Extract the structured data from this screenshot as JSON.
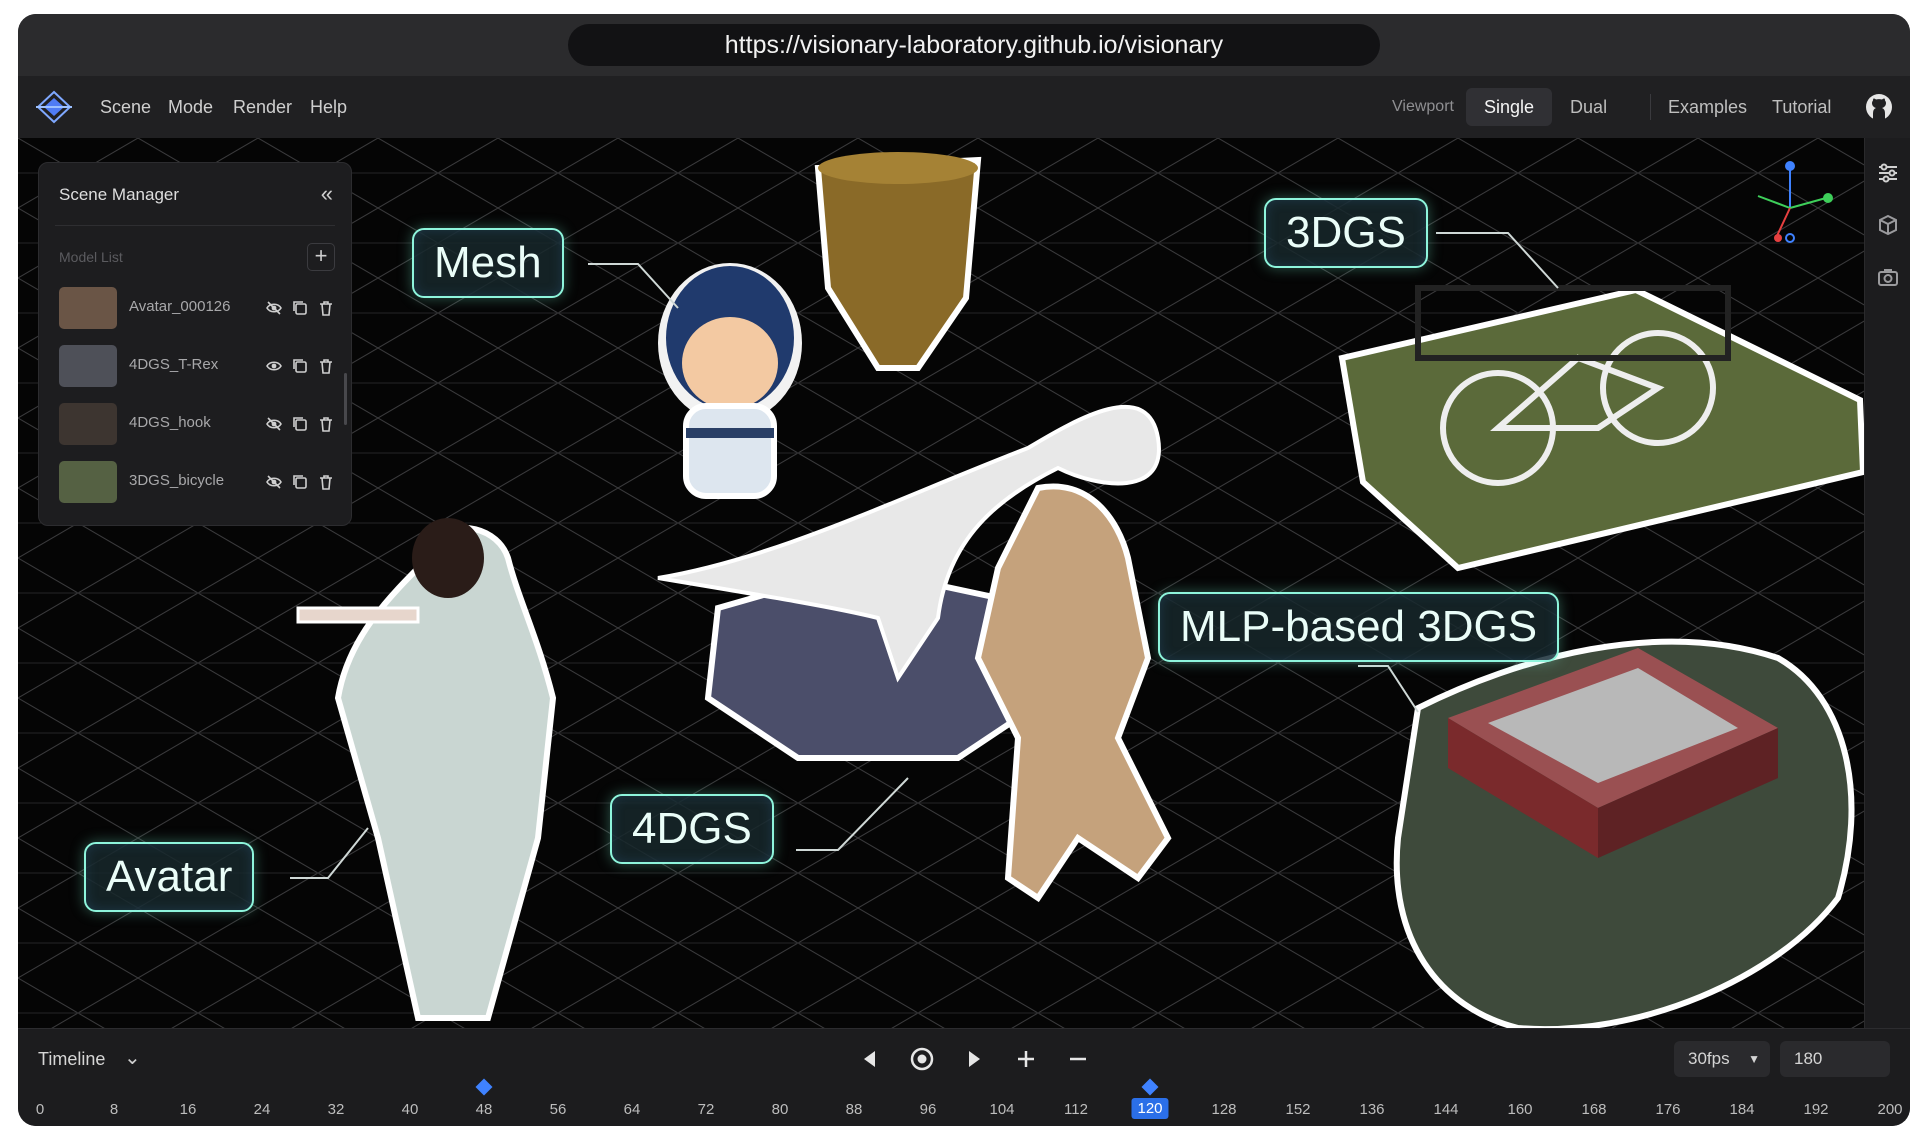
{
  "browser": {
    "url": "https://visionary-laboratory.github.io/visionary"
  },
  "menubar": {
    "items": [
      "Scene",
      "Mode",
      "Render",
      "Help"
    ],
    "viewport_label": "Viewport",
    "viewport_options": [
      "Single",
      "Dual"
    ],
    "viewport_active": "Single",
    "links": [
      "Examples",
      "Tutorial"
    ],
    "icons": {
      "logo": "app-logo-icon",
      "github": "github-icon"
    }
  },
  "scene_manager": {
    "title": "Scene Manager",
    "model_list_label": "Model List",
    "models": [
      {
        "name": "Avatar_000126"
      },
      {
        "name": "4DGS_T-Rex"
      },
      {
        "name": "4DGS_hook"
      },
      {
        "name": "3DGS_bicycle"
      }
    ]
  },
  "viewport_callouts": {
    "mesh": "Mesh",
    "gs3d": "3DGS",
    "mlp": "MLP-based 3DGS",
    "gs4d": "4DGS",
    "avatar": "Avatar"
  },
  "timeline": {
    "label": "Timeline",
    "fps": "30fps",
    "frames": "180",
    "ticks": [
      "0",
      "8",
      "16",
      "24",
      "32",
      "40",
      "48",
      "56",
      "64",
      "72",
      "80",
      "88",
      "96",
      "104",
      "112",
      "120",
      "128",
      "152",
      "136",
      "144",
      "160",
      "168",
      "176",
      "184",
      "192",
      "200"
    ],
    "current_tick": "120",
    "keyframes": [
      "48",
      "120"
    ]
  },
  "colors": {
    "accent": "#2b6fe8",
    "callout_border": "#8ef5dc",
    "background": "#050505"
  }
}
